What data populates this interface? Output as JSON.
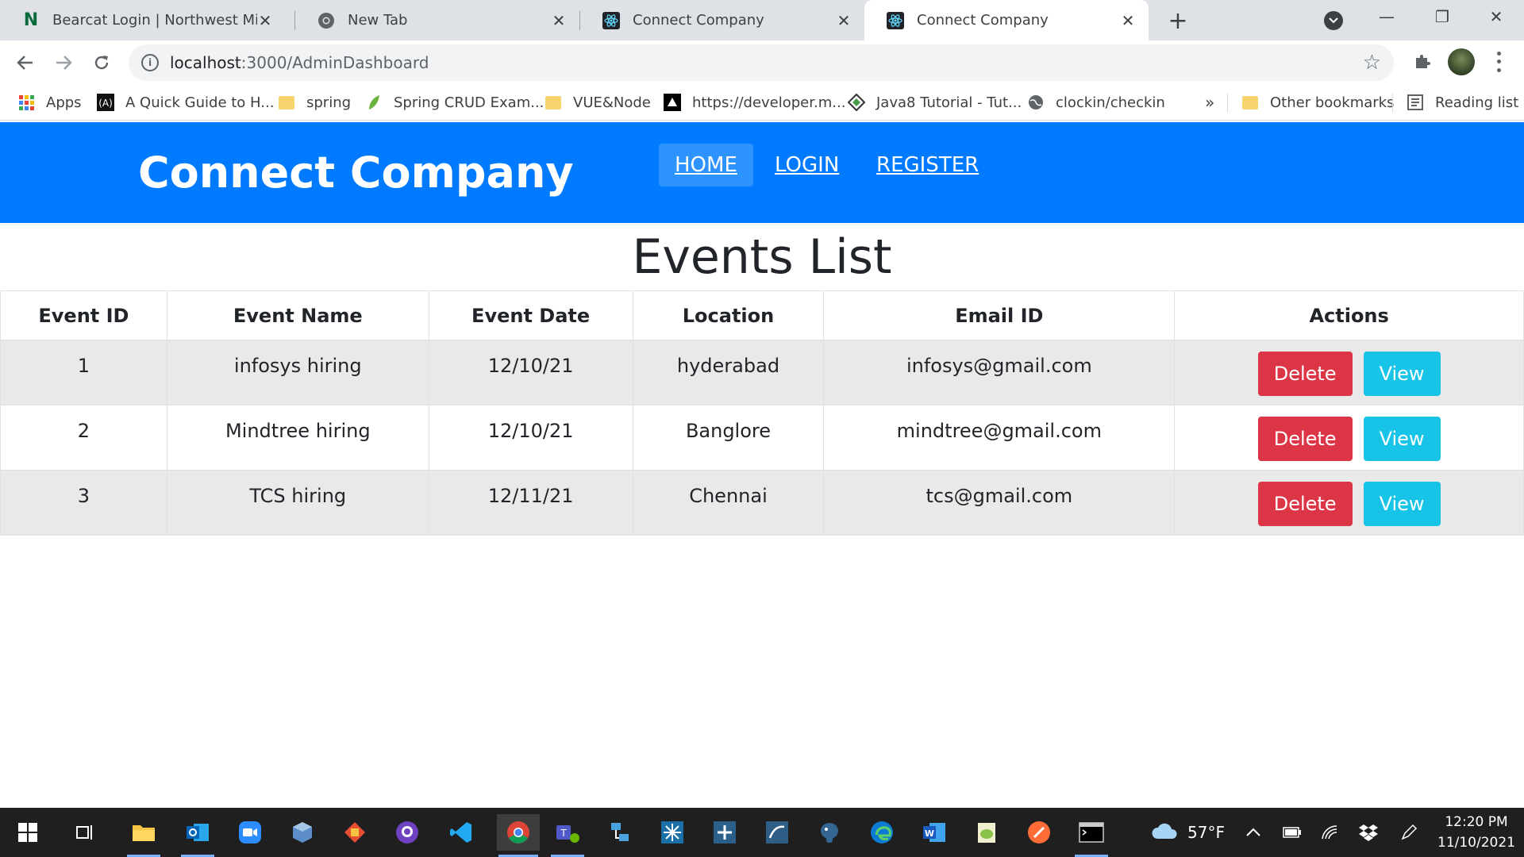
{
  "browser": {
    "tabs": [
      {
        "title": "Bearcat Login | Northwest Missou",
        "icon": "northwest-n-icon",
        "active": false
      },
      {
        "title": "New Tab",
        "icon": "chrome-icon",
        "active": false
      },
      {
        "title": "Connect Company",
        "icon": "react-icon",
        "active": false
      },
      {
        "title": "Connect Company",
        "icon": "react-icon",
        "active": true
      }
    ],
    "new_tab_symbol": "+",
    "close_symbol": "✕",
    "url_host": "localhost",
    "url_path": ":3000/AdminDashboard",
    "window_controls": {
      "minimize": "—",
      "restore": "❐",
      "close": "✕"
    },
    "bookmarks": [
      {
        "label": "Apps",
        "icon": "apps-grid-icon"
      },
      {
        "label": "A Quick Guide to H...",
        "icon": "bookmark-site-icon"
      },
      {
        "label": "spring",
        "icon": "folder-icon"
      },
      {
        "label": "Spring CRUD Exam...",
        "icon": "spring-leaf-icon"
      },
      {
        "label": "VUE&Node",
        "icon": "folder-icon"
      },
      {
        "label": "https://developer.m...",
        "icon": "bookmark-site-icon"
      },
      {
        "label": "Java8 Tutorial - Tut...",
        "icon": "bookmark-site-icon"
      },
      {
        "label": "clockin/checkin",
        "icon": "globe-icon"
      }
    ],
    "bookmarks_overflow": "»",
    "other_bookmarks": "Other bookmarks",
    "reading_list": "Reading list"
  },
  "app": {
    "brand": "Connect Company",
    "nav": [
      {
        "label": "HOME",
        "active": true
      },
      {
        "label": "LOGIN",
        "active": false
      },
      {
        "label": "REGISTER",
        "active": false
      }
    ],
    "title": "Events List",
    "table": {
      "columns": [
        "Event ID",
        "Event Name",
        "Event Date",
        "Location",
        "Email ID",
        "Actions"
      ],
      "rows": [
        {
          "id": "1",
          "name": "infosys hiring",
          "date": "12/10/21",
          "location": "hyderabad",
          "email": "infosys@gmail.com"
        },
        {
          "id": "2",
          "name": "Mindtree hiring",
          "date": "12/10/21",
          "location": "Banglore",
          "email": "mindtree@gmail.com"
        },
        {
          "id": "3",
          "name": "TCS hiring",
          "date": "12/11/21",
          "location": "Chennai",
          "email": "tcs@gmail.com"
        }
      ],
      "delete_label": "Delete",
      "view_label": "View"
    },
    "colors": {
      "navbar": "#007bff",
      "danger": "#dc3545",
      "info": "#17c3e6"
    }
  },
  "taskbar": {
    "weather": "57°F",
    "time": "12:20 PM",
    "date": "11/10/2021"
  }
}
